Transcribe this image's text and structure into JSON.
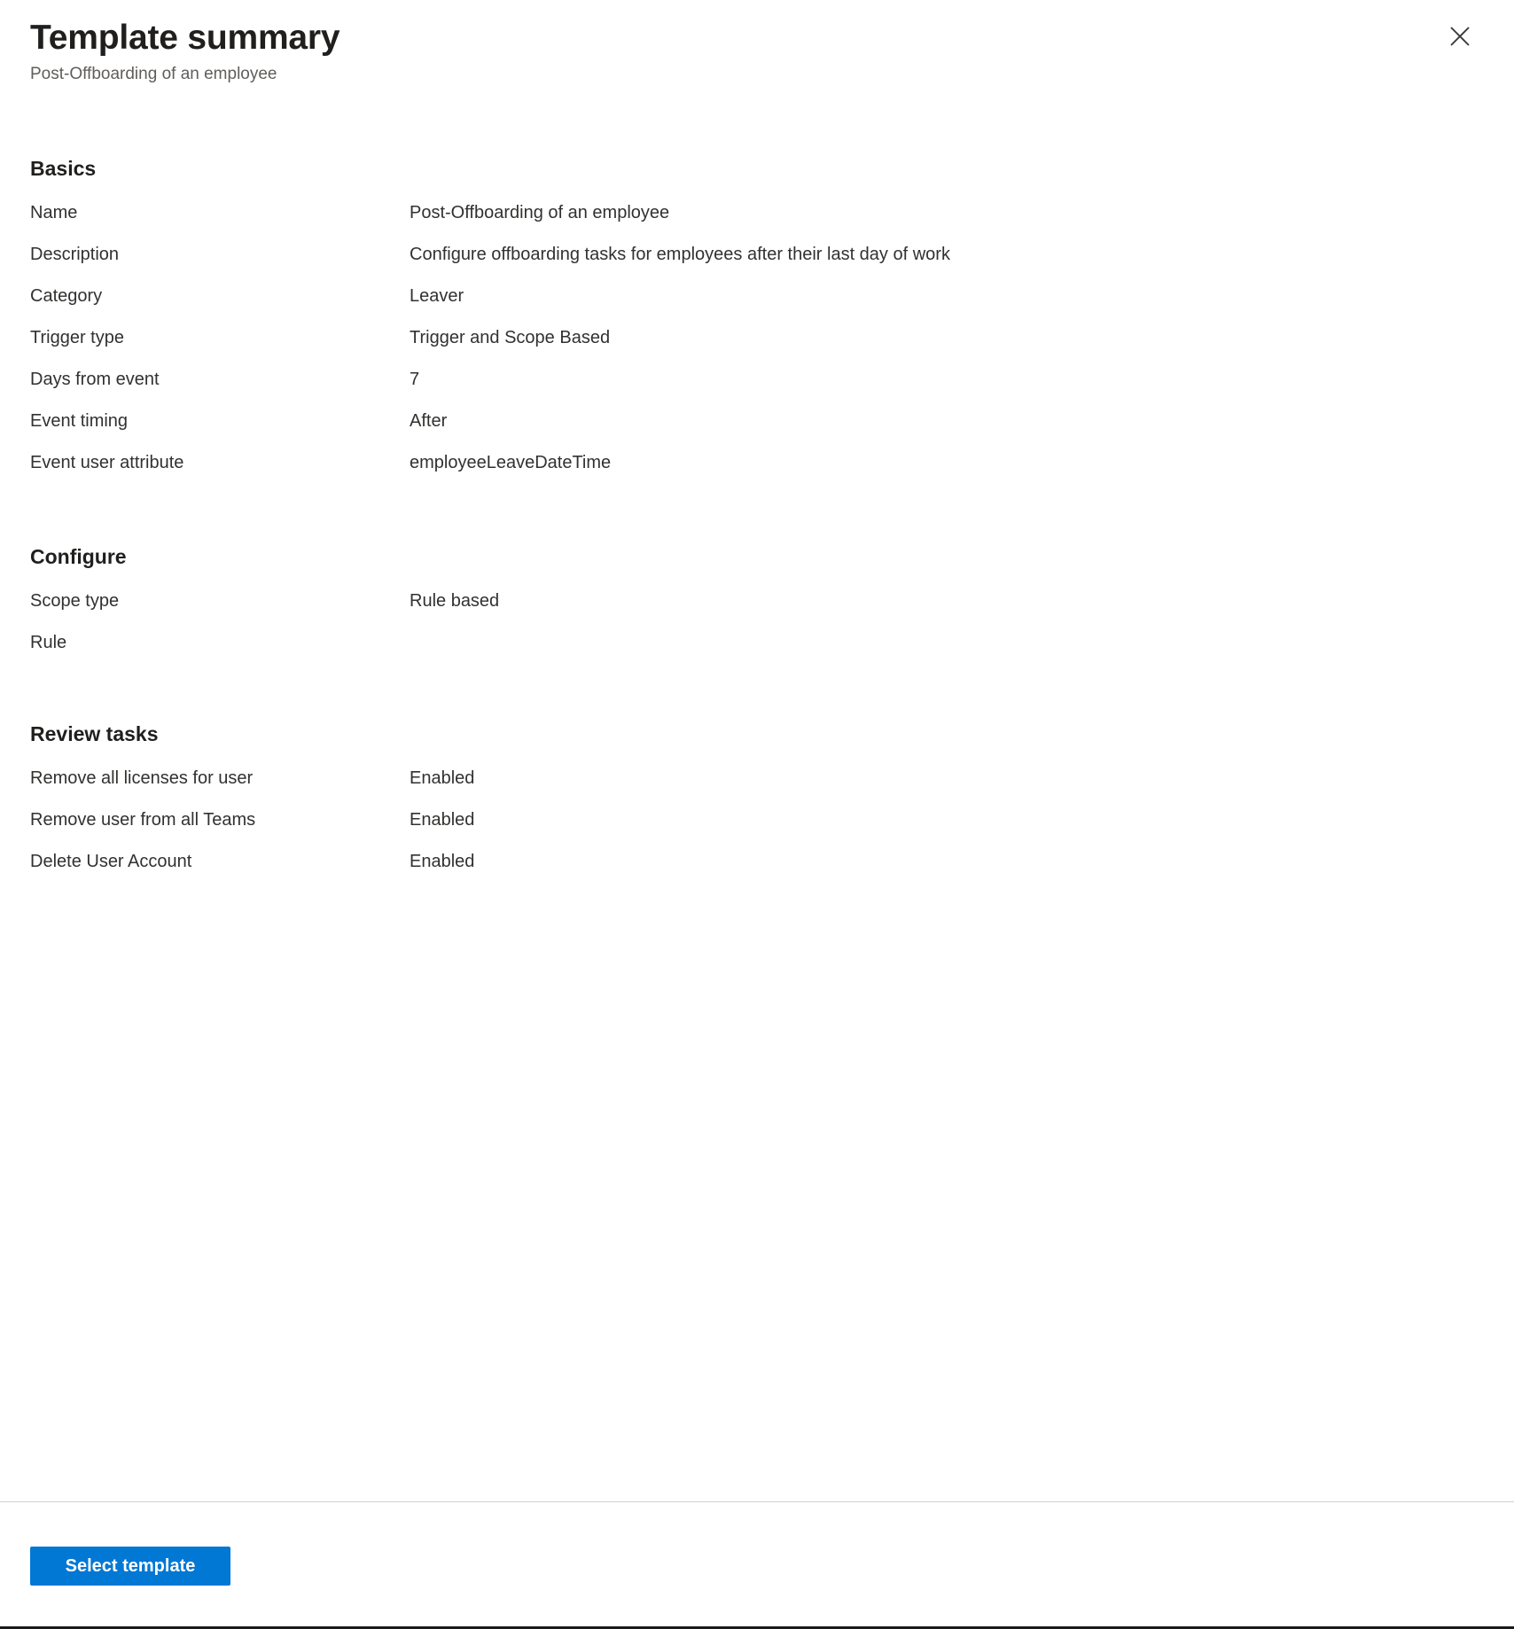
{
  "header": {
    "title": "Template summary",
    "subtitle": "Post-Offboarding of an employee",
    "close_icon": "close-icon"
  },
  "sections": [
    {
      "title": "Basics",
      "rows": [
        {
          "label": "Name",
          "value": "Post-Offboarding of an employee"
        },
        {
          "label": "Description",
          "value": "Configure offboarding tasks for employees after their last day of work"
        },
        {
          "label": "Category",
          "value": "Leaver"
        },
        {
          "label": "Trigger type",
          "value": "Trigger and Scope Based"
        },
        {
          "label": "Days from event",
          "value": "7"
        },
        {
          "label": "Event timing",
          "value": "After"
        },
        {
          "label": "Event user attribute",
          "value": "employeeLeaveDateTime"
        }
      ]
    },
    {
      "title": "Configure",
      "rows": [
        {
          "label": "Scope type",
          "value": "Rule based"
        },
        {
          "label": "Rule",
          "value": ""
        }
      ]
    },
    {
      "title": "Review tasks",
      "rows": [
        {
          "label": "Remove all licenses for user",
          "value": "Enabled"
        },
        {
          "label": "Remove user from all Teams",
          "value": "Enabled"
        },
        {
          "label": "Delete User Account",
          "value": "Enabled"
        }
      ]
    }
  ],
  "footer": {
    "select_template_label": "Select template"
  },
  "colors": {
    "accent": "#0078d4",
    "title_text": "#201f1e",
    "body_text": "#323130",
    "subtitle_text": "#605e5c",
    "divider": "#d2d0ce"
  }
}
